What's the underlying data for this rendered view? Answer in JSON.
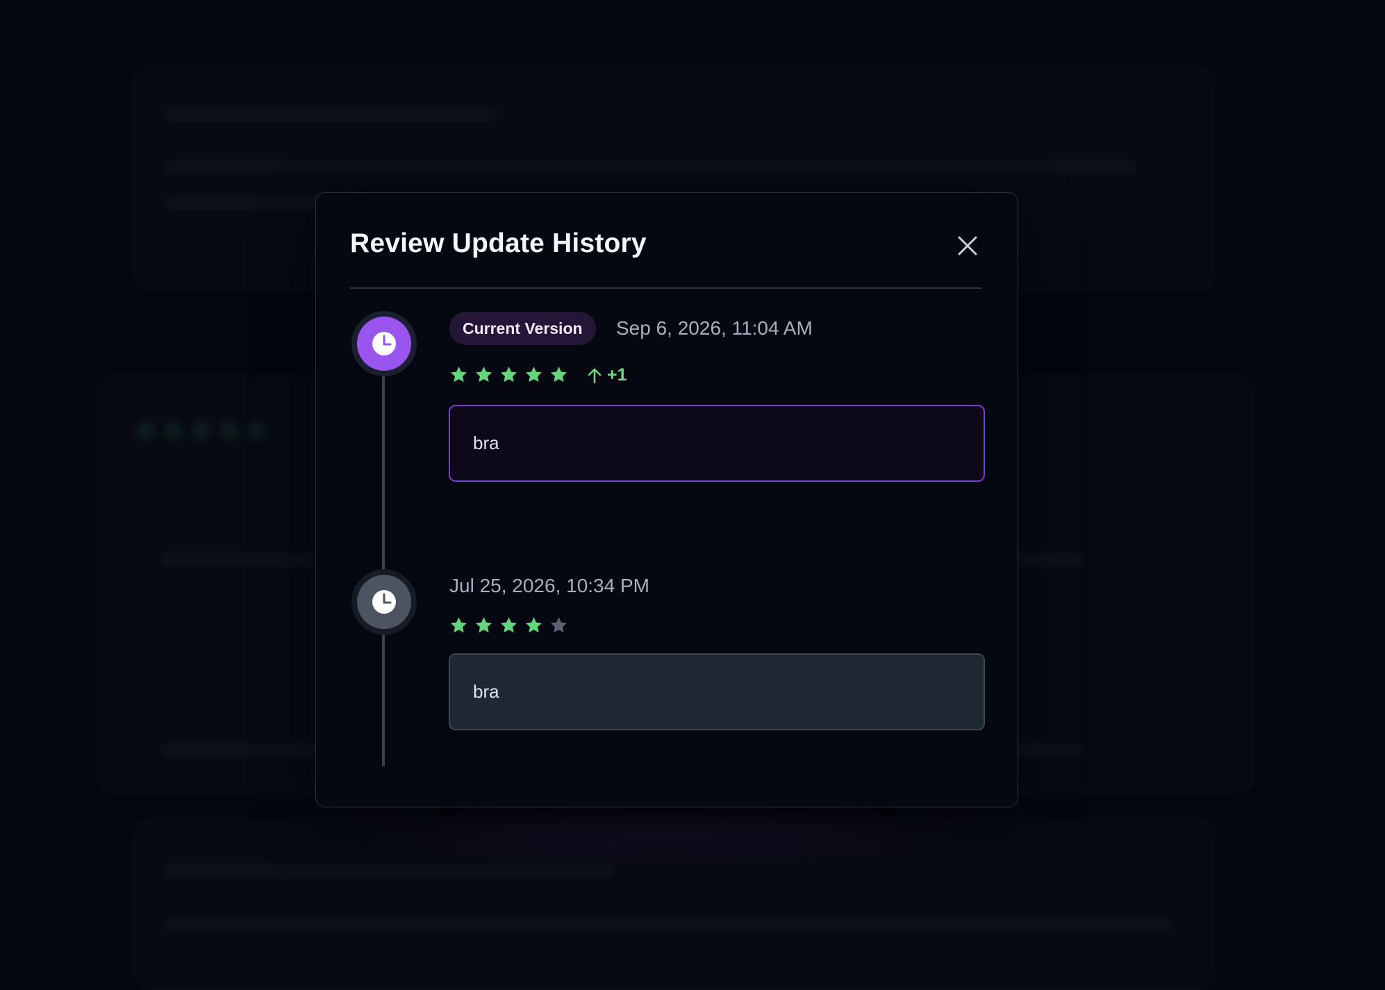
{
  "modal": {
    "title": "Review Update History",
    "close_icon": "close-icon"
  },
  "entries": [
    {
      "badge": "Current Version",
      "timestamp": "Sep 6, 2026, 11:04 AM",
      "rating": 5,
      "rating_max": 5,
      "rating_change": "+1",
      "text": "bra",
      "icon": "clock-icon"
    },
    {
      "timestamp": "Jul 25, 2026, 10:34 PM",
      "rating": 4,
      "rating_max": 5,
      "text": "bra",
      "icon": "clock-icon"
    }
  ],
  "colors": {
    "accent": "#9a55ee",
    "star_active": "#66d47d",
    "star_inactive": "#5b6271",
    "panel_background": "#060811"
  }
}
